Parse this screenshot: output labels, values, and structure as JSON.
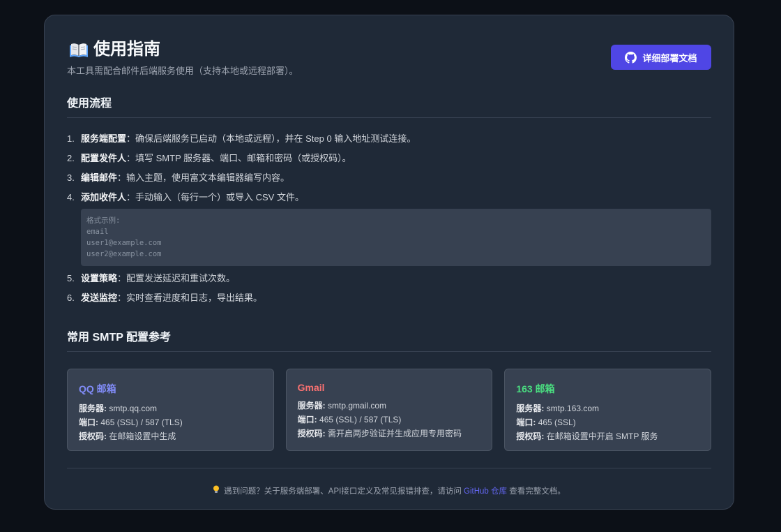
{
  "header": {
    "title": "使用指南",
    "subtitle": "本工具需配合邮件后端服务使用（支持本地或远程部署）。",
    "docs_button": "详细部署文档"
  },
  "workflow": {
    "title": "使用流程",
    "steps": [
      {
        "num": "1.",
        "label": "服务端配置",
        "text": "：确保后端服务已启动（本地或远程），并在 Step 0 输入地址测试连接。"
      },
      {
        "num": "2.",
        "label": "配置发件人",
        "text": "：填写 SMTP 服务器、端口、邮箱和密码（或授权码）。"
      },
      {
        "num": "3.",
        "label": "编辑邮件",
        "text": "：输入主题，使用富文本编辑器编写内容。"
      },
      {
        "num": "4.",
        "label": "添加收件人",
        "text": "：手动输入（每行一个）或导入 CSV 文件。"
      },
      {
        "num": "5.",
        "label": "设置策略",
        "text": "：配置发送延迟和重试次数。"
      },
      {
        "num": "6.",
        "label": "发送监控",
        "text": "：实时查看进度和日志，导出结果。"
      }
    ],
    "code_lines": [
      "格式示例:",
      "email",
      "user1@example.com",
      "user2@example.com"
    ]
  },
  "smtp": {
    "title": "常用 SMTP 配置参考",
    "server_label": "服务器:",
    "port_label": "端口:",
    "auth_label": "授权码:",
    "cards": [
      {
        "name": "QQ 邮箱",
        "color": "#818cf8",
        "server": "smtp.qq.com",
        "port": "465 (SSL) / 587 (TLS)",
        "auth": "在邮箱设置中生成"
      },
      {
        "name": "Gmail",
        "color": "#f87171",
        "server": "smtp.gmail.com",
        "port": "465 (SSL) / 587 (TLS)",
        "auth": "需开启两步验证并生成应用专用密码"
      },
      {
        "name": "163 邮箱",
        "color": "#4ade80",
        "server": "smtp.163.com",
        "port": "465 (SSL)",
        "auth": "在邮箱设置中开启 SMTP 服务"
      }
    ]
  },
  "footer": {
    "prefix": "遇到问题？关于服务端部署、API接口定义及常见报错排查，请访问 ",
    "link": "GitHub 仓库",
    "suffix": " 查看完整文档。"
  },
  "icons": {
    "title": "book-icon",
    "button": "github-icon",
    "footer": "lightbulb-icon"
  }
}
